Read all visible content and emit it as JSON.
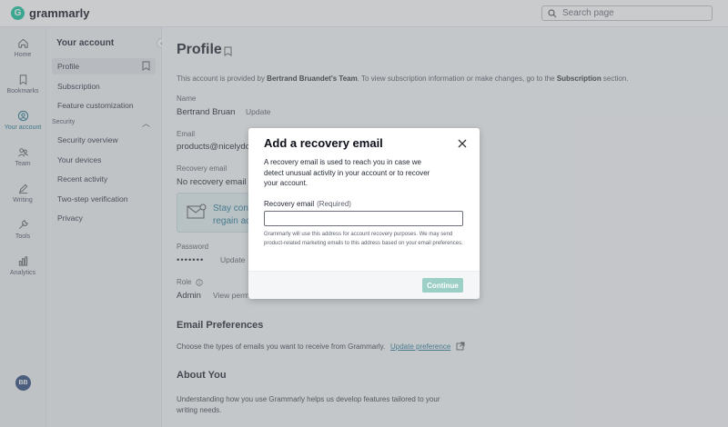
{
  "app": {
    "name": "grammarly"
  },
  "search": {
    "placeholder": "Search page"
  },
  "rail": {
    "items": [
      {
        "label": "Home",
        "icon": "home-icon"
      },
      {
        "label": "Bookmarks",
        "icon": "bookmark-icon"
      },
      {
        "label": "Your account",
        "icon": "account-icon",
        "active": true
      },
      {
        "label": "Team",
        "icon": "team-icon"
      },
      {
        "label": "Writing",
        "icon": "pen-icon"
      },
      {
        "label": "Tools",
        "icon": "tools-icon"
      },
      {
        "label": "Analytics",
        "icon": "analytics-icon"
      }
    ],
    "avatar_initials": "BB"
  },
  "sidebar": {
    "title": "Your account",
    "items": [
      {
        "label": "Profile",
        "active": true
      },
      {
        "label": "Subscription"
      },
      {
        "label": "Feature customization"
      }
    ],
    "security_section": "Security",
    "security_items": [
      {
        "label": "Security overview"
      },
      {
        "label": "Your devices"
      },
      {
        "label": "Recent activity"
      },
      {
        "label": "Two-step verification"
      },
      {
        "label": "Privacy"
      }
    ]
  },
  "profile": {
    "title": "Profile",
    "note_pre": "This account is provided by ",
    "note_team": "Bertrand Bruandet's Team",
    "note_mid": ". To view subscription information or make changes, go to the ",
    "note_link": "Subscription",
    "note_post": " section.",
    "name_label": "Name",
    "name_value": "Bertrand Bruan",
    "name_update": "Update",
    "email_label": "Email",
    "email_value": "products@nicelydo",
    "recovery_label": "Recovery email",
    "recovery_value": "No recovery email a",
    "banner_line1": "Stay conn",
    "banner_line2": "regain acc",
    "password_label": "Password",
    "password_value": "•••••••",
    "password_update": "Update",
    "role_label": "Role",
    "role_value": "Admin",
    "role_link": "View perm",
    "email_prefs_title": "Email Preferences",
    "email_prefs_text": "Choose the types of emails you want to receive from Grammarly.",
    "email_prefs_link": "Update preference",
    "about_title": "About You",
    "about_text": "Understanding how you use Grammarly helps us develop features tailored to your writing needs."
  },
  "dialog": {
    "title": "Add a recovery email",
    "description": "A recovery email is used to reach you in case we detect unusual activity in your account or to recover your account.",
    "field_label": "Recovery email",
    "field_required": "(Required)",
    "field_value": "",
    "fine_print": "Grammarly will use this address for account recovery purposes. We may send product-related marketing emails to this address based on your email preferences.",
    "continue_label": "Continue"
  }
}
